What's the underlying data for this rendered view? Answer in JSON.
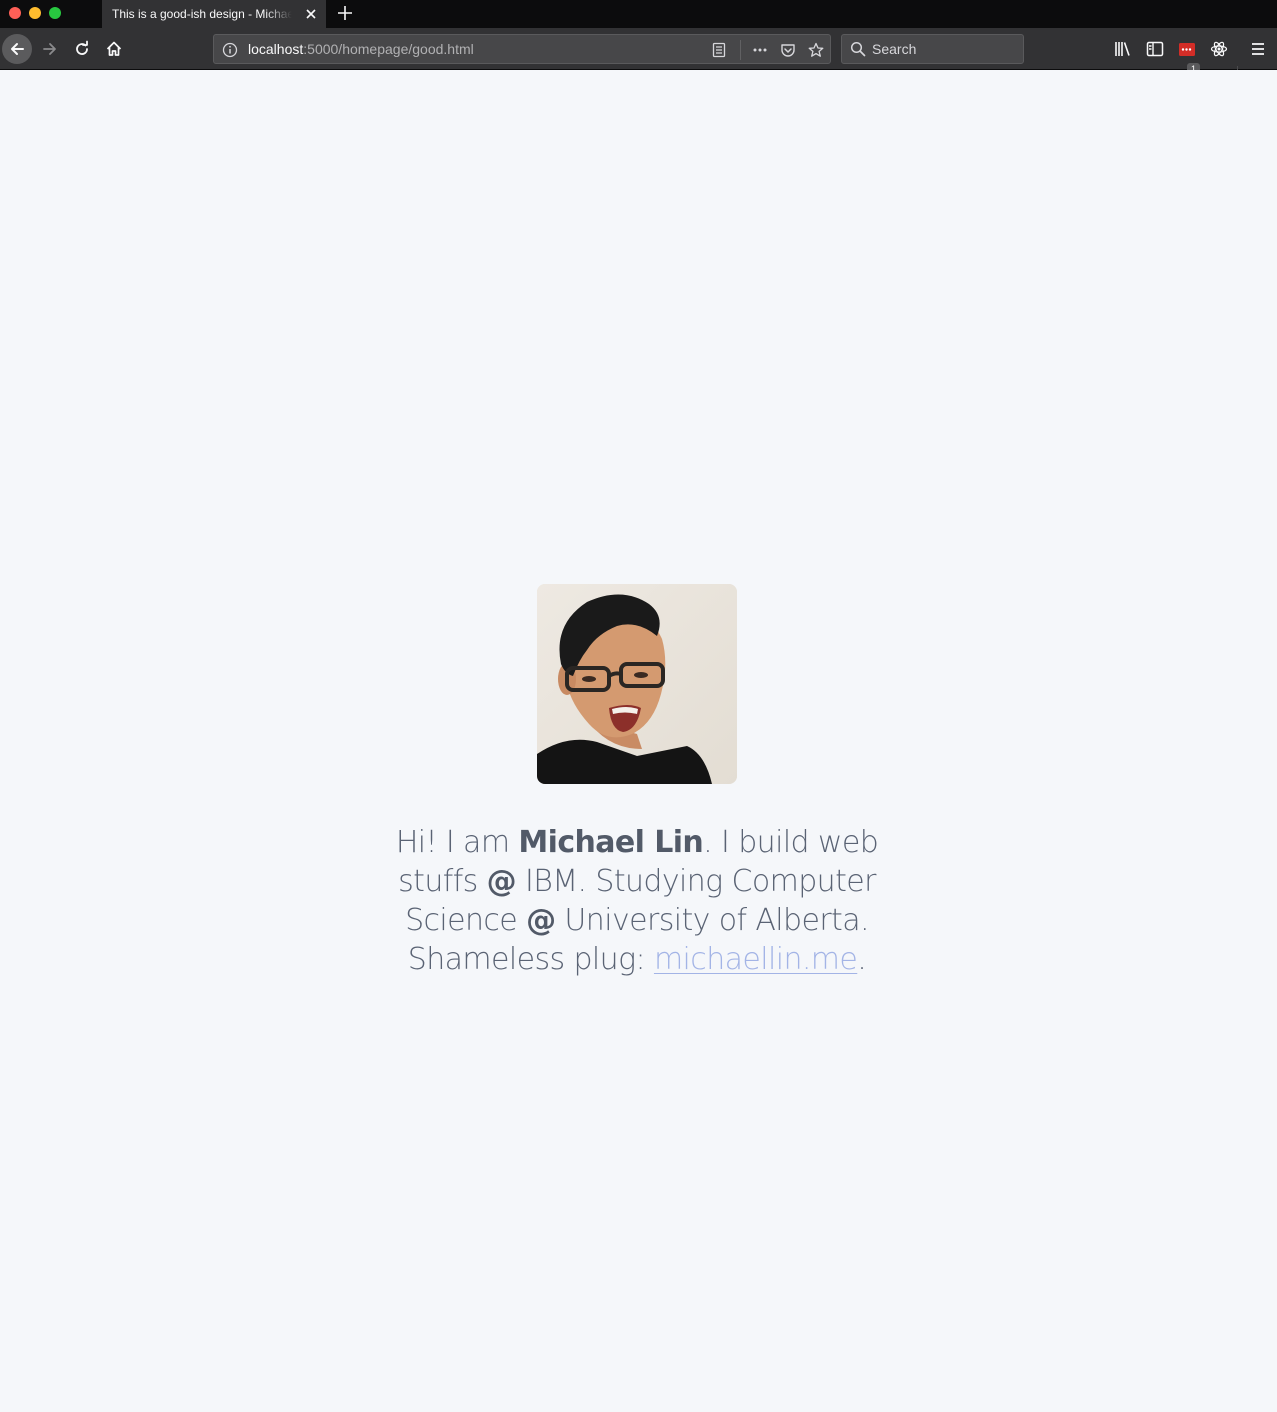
{
  "browser": {
    "tab_title": "This is a good-ish design - Michael",
    "url_host": "localhost",
    "url_path": ":5000/homepage/good.html",
    "search_placeholder": "Search",
    "downloads_badge": "1"
  },
  "page": {
    "bio_intro": "Hi! I am ",
    "name": "Michael Lin",
    "bio_part1": ". I build web stuffs ",
    "at1": "@",
    "bio_part2": " IBM. Studying Computer Science ",
    "at2": "@",
    "bio_part3": " University of Alberta. Shameless plug: ",
    "link_text": "michaellin.me",
    "bio_end": "."
  },
  "colors": {
    "page_bg": "#f5f7fa",
    "text": "#5a6374",
    "link": "#a3b4e6",
    "toolbar": "#323234"
  }
}
